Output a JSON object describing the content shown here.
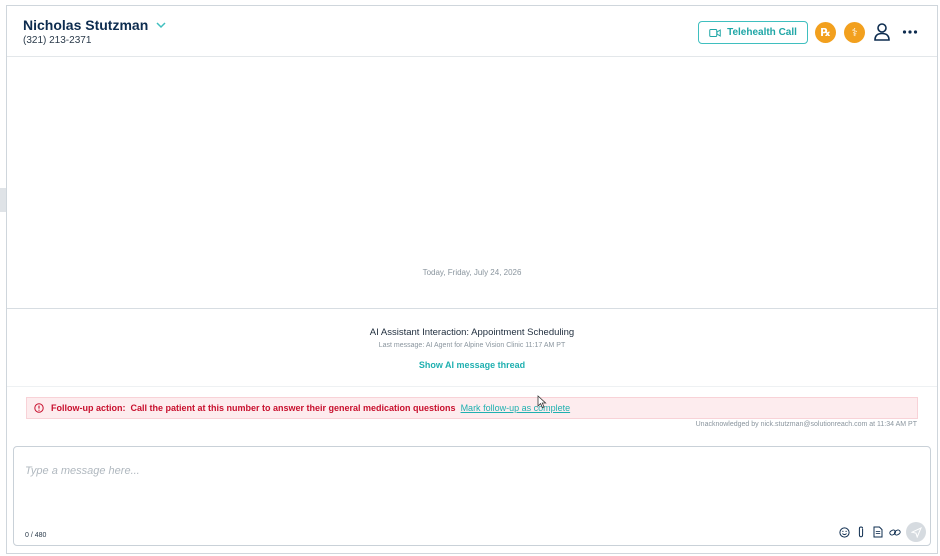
{
  "header": {
    "patient_name": "Nicholas Stutzman",
    "patient_phone": "(321) 213-2371",
    "telehealth_label": "Telehealth Call",
    "rx_label": "℞",
    "med_label": "⚕"
  },
  "thread": {
    "date_separator": "Today, Friday, July 24, 2026",
    "ai_interaction_title": "AI Assistant Interaction: Appointment Scheduling",
    "ai_last_message": "Last message: AI Agent for Alpine Vision Clinic 11:17 AM PT",
    "ai_show_thread": "Show AI message thread"
  },
  "followup": {
    "label": "Follow-up action:",
    "text": "Call the patient at this number to answer their general medication questions",
    "link": "Mark follow-up as complete",
    "ack": "Unacknowledged by nick.stutzman@solutionreach.com at 11:34 AM PT"
  },
  "composer": {
    "placeholder": "Type a message here...",
    "value": "",
    "char_count": "0 / 480"
  },
  "icons": {
    "chevron": "chevron-down-icon",
    "video": "video-icon",
    "user": "user-icon",
    "more": "more-horizontal-icon",
    "warning": "warning-circle-icon",
    "emoji": "emoji-icon",
    "attach": "paperclip-icon",
    "document": "document-icon",
    "link": "link-icon",
    "send": "send-icon"
  },
  "colors": {
    "brand_navy": "#0d2c4f",
    "accent_teal": "#1fb0b0",
    "warning_orange": "#f2a01e",
    "alert_red": "#c8102e",
    "alert_bg": "#fdecee"
  }
}
